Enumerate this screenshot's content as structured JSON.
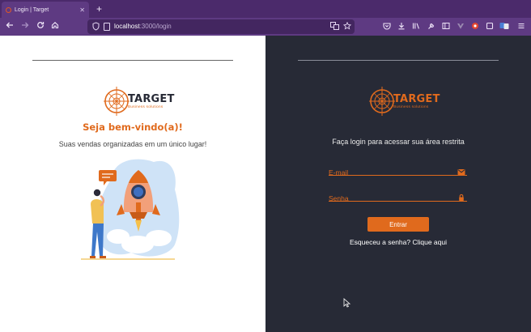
{
  "browser": {
    "tab_title": "Login | Target",
    "tab_close": "✕",
    "new_tab": "+",
    "url_host": "localhost",
    "url_path": ":3000/login"
  },
  "brand": {
    "name": "TARGET",
    "tagline": "Business solutions",
    "accent_color": "#e06a1d",
    "dark_bg": "#272a36"
  },
  "left": {
    "welcome": "Seja bem-vindo(a)!",
    "subtitle": "Suas vendas organizadas em um único lugar!"
  },
  "login": {
    "title": "Faça login para acessar sua área restrita",
    "email_placeholder": "E-mail",
    "email_value": "",
    "password_placeholder": "Senha",
    "password_value": "",
    "submit_label": "Entrar",
    "forgot_label": "Esqueceu a senha? Clique aqui"
  },
  "icons": {
    "email": "envelope-icon",
    "password": "lock-icon"
  }
}
